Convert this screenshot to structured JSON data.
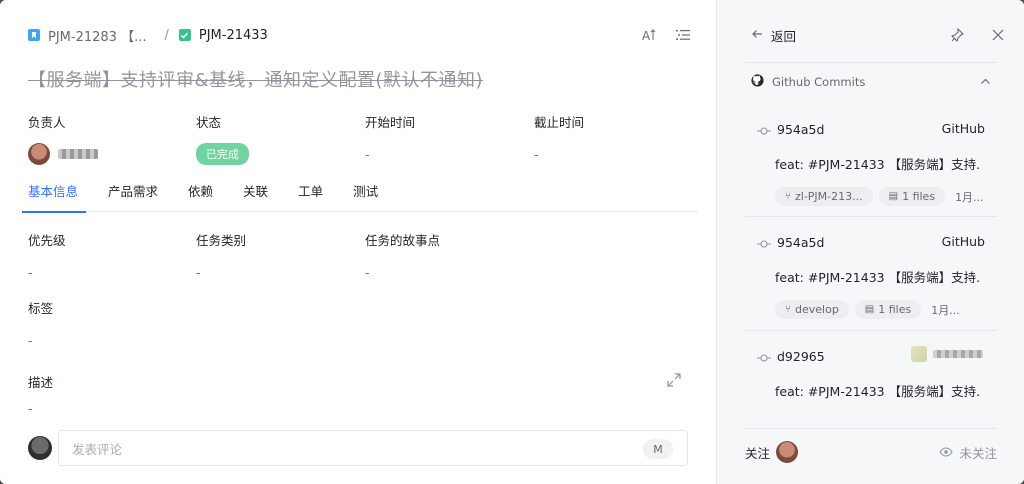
{
  "breadcrumb": {
    "parent_id": "PJM-21283 【...",
    "separator": "/",
    "current_id": "PJM-21433"
  },
  "title": "【服务端】支持评审&基线，通知定义配置(默认不通知)",
  "fields": [
    {
      "label": "负责人",
      "value": ""
    },
    {
      "label": "状态",
      "value": "已完成"
    },
    {
      "label": "开始时间",
      "value": "-"
    },
    {
      "label": "截止时间",
      "value": "-"
    }
  ],
  "tabs": [
    {
      "label": "基本信息",
      "active": true
    },
    {
      "label": "产品需求"
    },
    {
      "label": "依赖"
    },
    {
      "label": "关联"
    },
    {
      "label": "工单"
    },
    {
      "label": "测试"
    }
  ],
  "info": {
    "priority": {
      "label": "优先级",
      "value": "-"
    },
    "task_type": {
      "label": "任务类别",
      "value": "-"
    },
    "story_points": {
      "label": "任务的故事点",
      "value": "-"
    },
    "tags": {
      "label": "标签",
      "value": "-"
    },
    "description": {
      "label": "描述",
      "value": "-"
    }
  },
  "comment": {
    "placeholder": "发表评论",
    "shortcut": "M"
  },
  "panel": {
    "back_label": "返回",
    "section_title": "Github Commits",
    "commits": [
      {
        "hash": "954a5d",
        "source": "GitHub",
        "message": "feat: #PJM-21433 【服务端】支持...",
        "branch": "zl-PJM-213...",
        "files": "1 files",
        "date": "1月..."
      },
      {
        "hash": "954a5d",
        "source": "GitHub",
        "message": "feat: #PJM-21433 【服务端】支持...",
        "branch": "develop",
        "files": "1 files",
        "date": "1月..."
      },
      {
        "hash": "d92965",
        "source": "",
        "message": "feat: #PJM-21433 【服务端】支持..."
      }
    ],
    "follow_label": "关注",
    "unfollow_label": "未关注"
  },
  "colors": {
    "accent": "#3370ff",
    "done_badge": "#6fd49f",
    "panel_bg": "#f6f7f9"
  }
}
